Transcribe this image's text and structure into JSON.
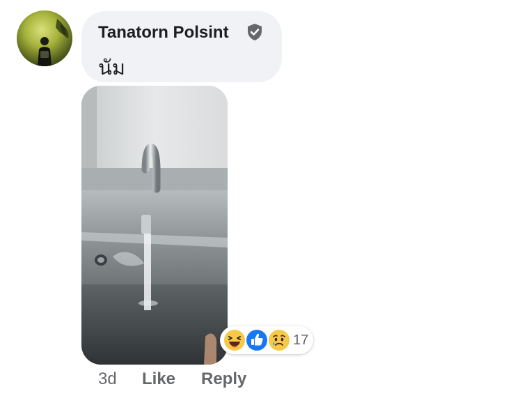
{
  "comment": {
    "author": "Tanatorn Polsint",
    "verified_icon": "shield-check-icon",
    "text": "นัม",
    "photo_alt": "photo-attachment",
    "timestamp": "3d",
    "actions": {
      "like_label": "Like",
      "reply_label": "Reply"
    },
    "reactions": {
      "icons": [
        "laughing-emoji-icon",
        "thumbs-up-icon",
        "sad-emoji-icon"
      ],
      "count": "17"
    }
  },
  "colors": {
    "bubble_bg": "#f0f2f5",
    "meta_text": "#65676b",
    "like_blue": "#1877f2",
    "emoji_yellow": "#f7c948"
  }
}
